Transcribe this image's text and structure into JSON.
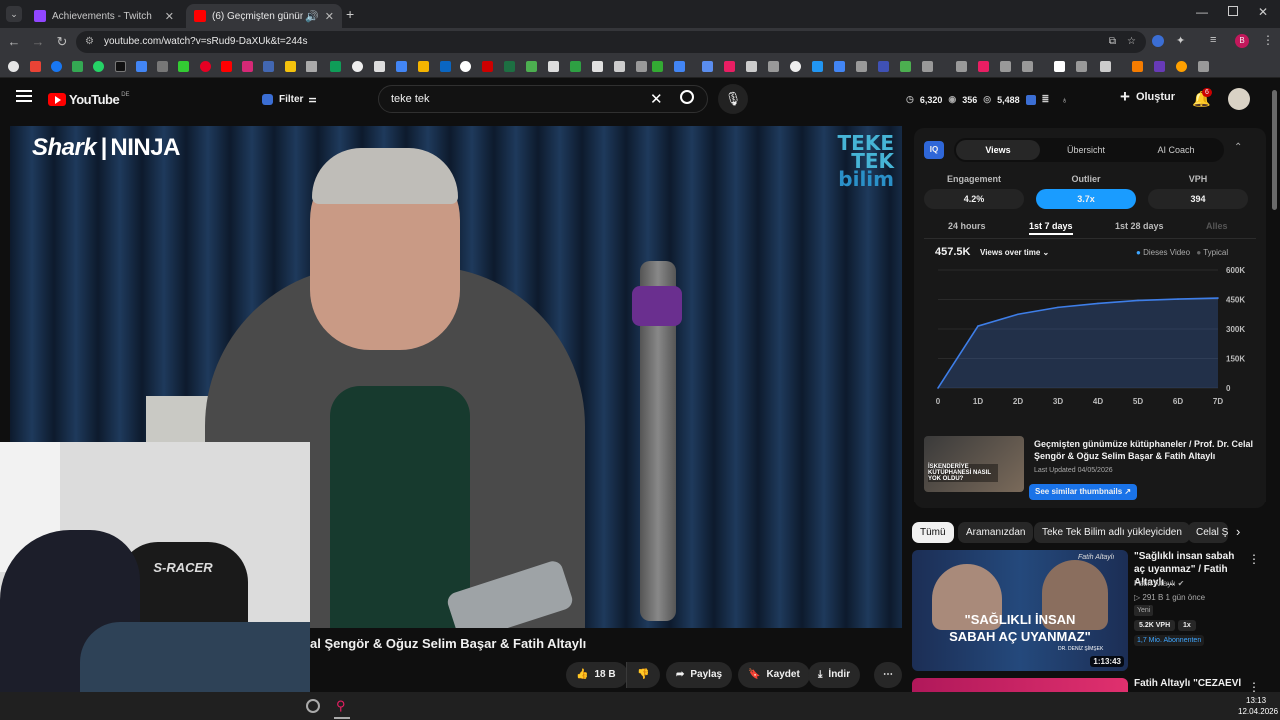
{
  "browser": {
    "tabs": [
      {
        "label": "Achievements - Twitch",
        "active": false
      },
      {
        "label": "(6) Geçmişten günümüze k",
        "active": true
      }
    ],
    "url": "youtube.com/watch?v=sRud9-DaXUk&t=244s"
  },
  "youtube": {
    "logo_text": "YouTube",
    "region": "DE",
    "filter_label": "Filter",
    "search_value": "teke tek",
    "stats": {
      "views_a": "6,320",
      "views_b": "356",
      "views_c": "5,488"
    },
    "create_label": "Oluştur",
    "notif_count": "6"
  },
  "video": {
    "brand_shark": "Shark",
    "brand_ninja": "NINJA",
    "channel_logo_top": "TEKE",
    "channel_logo_mid": "TEK",
    "channel_logo_bot": "bilim",
    "webcam_chair_text": "S-RACER",
    "title_visible": "al Şengör & Oğuz Selim Başar & Fatih Altaylı",
    "actions": {
      "like": "18 B",
      "share": "Paylaş",
      "save": "Kaydet",
      "download": "İndir"
    }
  },
  "iq_panel": {
    "logo": "IQ",
    "tabs": [
      "Views",
      "Übersicht",
      "AI Coach"
    ],
    "active_tab": "Views",
    "metrics": [
      {
        "label": "Engagement",
        "value": "4.2%"
      },
      {
        "label": "Outlier",
        "value": "3.7x"
      },
      {
        "label": "VPH",
        "value": "394"
      }
    ],
    "ranges": [
      "24 hours",
      "1st 7 days",
      "1st 28 days",
      "Alles"
    ],
    "active_range": "1st 7 days",
    "total_views": "457.5K",
    "views_dropdown": "Views over time",
    "legend": [
      "Dieses Video",
      "Typical"
    ],
    "similar": {
      "title": "Geçmişten günümüze kütüphaneler / Prof. Dr. Celal Şengör & Oğuz Selim Başar & Fatih Altaylı",
      "updated": "Last Updated 04/05/2026",
      "thumb_text": "İSKENDERİYE KÜTÜPHANESİ NASIL YOK OLDU?",
      "button": "See similar thumbnails"
    }
  },
  "chart_data": {
    "type": "area",
    "x": [
      "0",
      "1D",
      "2D",
      "3D",
      "4D",
      "5D",
      "6D",
      "7D"
    ],
    "series": [
      {
        "name": "Dieses Video",
        "values": [
          0,
          315000,
          375000,
          410000,
          430000,
          445000,
          452000,
          457500
        ]
      }
    ],
    "y_ticks": [
      "0",
      "150K",
      "300K",
      "450K",
      "600K"
    ],
    "ylim": [
      0,
      600000
    ],
    "legend_position": "top-right"
  },
  "chips": [
    "Tümü",
    "Aramanızdan",
    "Teke Tek Bilim adlı yükleyiciden",
    "Celal Ş"
  ],
  "recommendations": [
    {
      "title": "\"Sağlıklı insan sabah aç uyanmaz\" / Fatih Altaylı ...",
      "channel": "Fatih Altaylı",
      "meta": "291 B  1 gün önce",
      "badge": "Yeni",
      "vph": "5.2K VPH",
      "mult": "1x",
      "subs": "1,7 Mio. Abonnenten",
      "duration": "1:13:43",
      "thumb_line1": "\"SAĞLIKLI İNSAN",
      "thumb_line2": "SABAH AÇ UYANMAZ\"",
      "thumb_name": "DR. DENİZ ŞİMŞEK",
      "thumb_sig": "Fatih Altaylı"
    },
    {
      "title": "Fatih Altaylı \"CEZAEVİ"
    }
  ],
  "taskbar": {
    "time": "13:13",
    "date": "12.04.2026"
  },
  "colors": {
    "accent": "#3ea6ff",
    "outlier": "#1a9cff",
    "yt_red": "#ff0000"
  }
}
